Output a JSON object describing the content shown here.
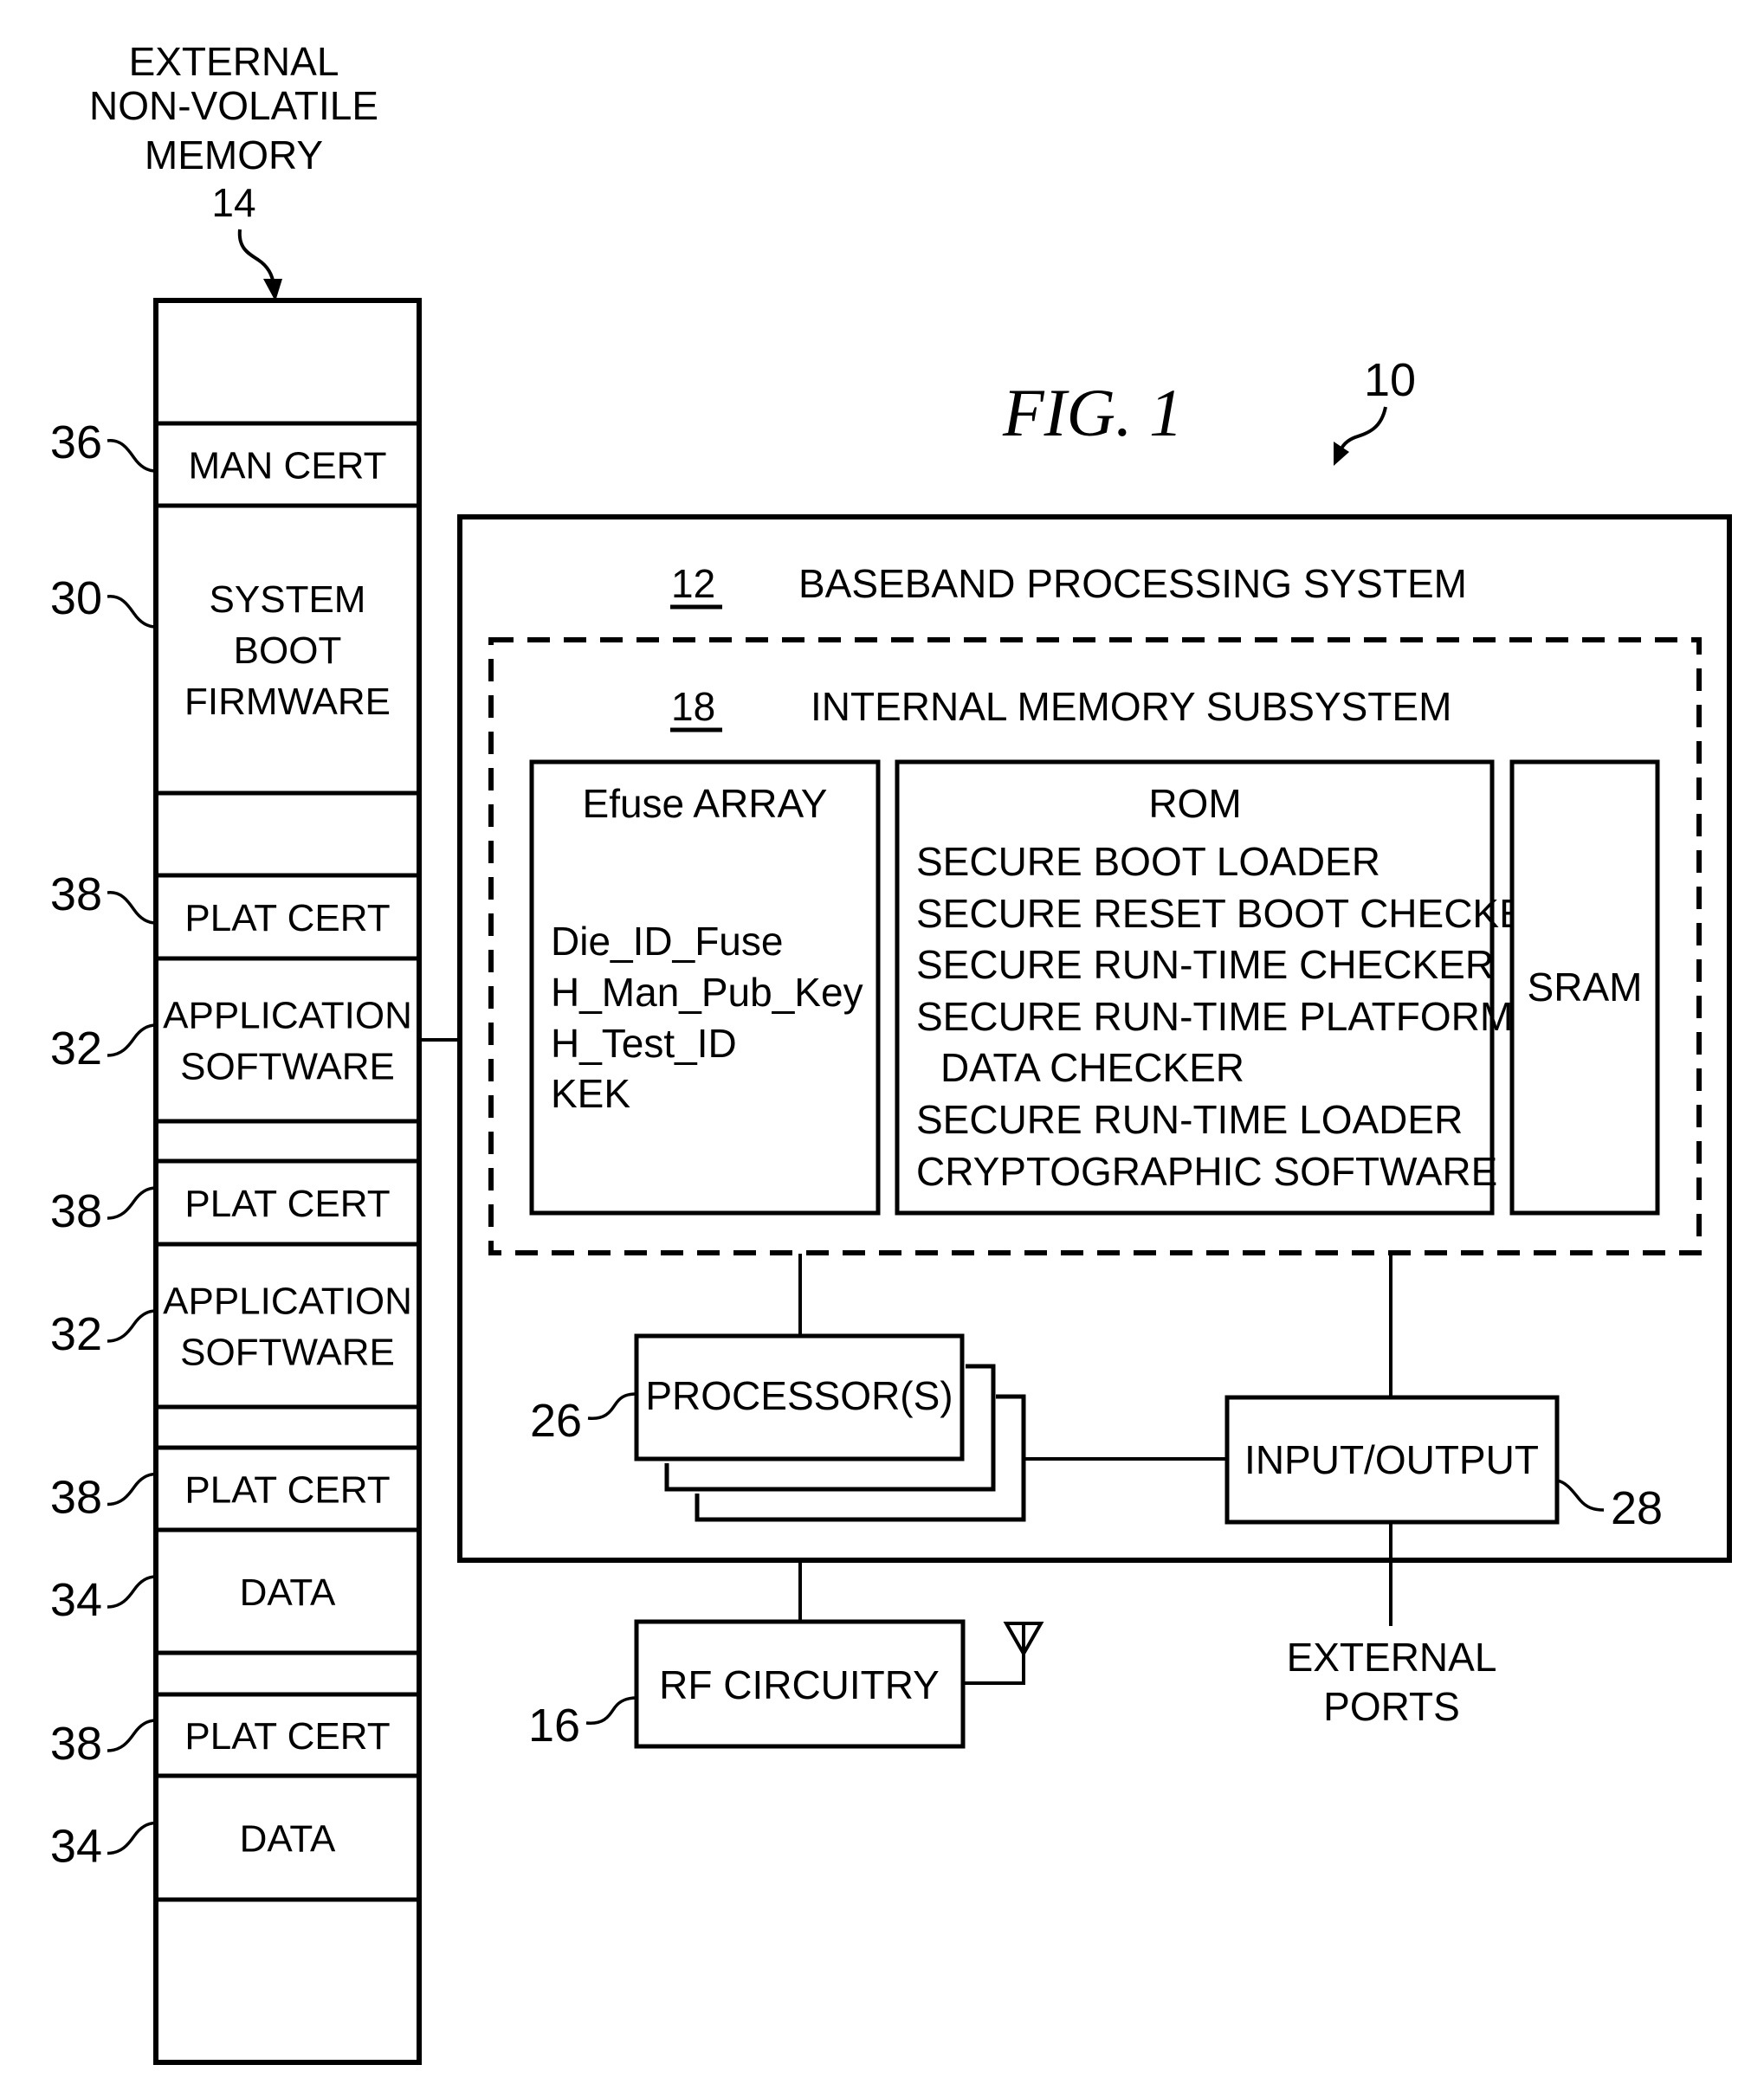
{
  "figure": {
    "title": "FIG. 1",
    "system_ref": "10"
  },
  "external_memory": {
    "title_lines": [
      "EXTERNAL",
      "NON-VOLATILE",
      "MEMORY"
    ],
    "ref": "14",
    "segments": [
      {
        "label_lines": [],
        "ref": ""
      },
      {
        "label_lines": [
          "MAN CERT"
        ],
        "ref": "36"
      },
      {
        "label_lines": [
          "SYSTEM",
          "BOOT",
          "FIRMWARE"
        ],
        "ref": "30"
      },
      {
        "label_lines": [],
        "ref": ""
      },
      {
        "label_lines": [
          "PLAT CERT"
        ],
        "ref": "38"
      },
      {
        "label_lines": [
          "APPLICATION",
          "SOFTWARE"
        ],
        "ref": "32"
      },
      {
        "label_lines": [],
        "ref": ""
      },
      {
        "label_lines": [
          "PLAT CERT"
        ],
        "ref": "38"
      },
      {
        "label_lines": [
          "APPLICATION",
          "SOFTWARE"
        ],
        "ref": "32"
      },
      {
        "label_lines": [],
        "ref": ""
      },
      {
        "label_lines": [
          "PLAT CERT"
        ],
        "ref": "38"
      },
      {
        "label_lines": [
          "DATA"
        ],
        "ref": "34"
      },
      {
        "label_lines": [],
        "ref": ""
      },
      {
        "label_lines": [
          "PLAT CERT"
        ],
        "ref": "38"
      },
      {
        "label_lines": [
          "DATA"
        ],
        "ref": "34"
      },
      {
        "label_lines": [],
        "ref": ""
      }
    ]
  },
  "baseband": {
    "ref": "12",
    "title": "BASEBAND PROCESSING SYSTEM"
  },
  "internal_memory": {
    "ref": "18",
    "title": "INTERNAL MEMORY SUBSYSTEM",
    "efuse": {
      "title": "Efuse ARRAY",
      "items": [
        "Die_ID_Fuse",
        "H_Man_Pub_Key",
        "H_Test_ID",
        "KEK"
      ]
    },
    "rom": {
      "title": "ROM",
      "items": [
        "SECURE BOOT LOADER",
        "SECURE RESET BOOT CHECKER",
        "SECURE RUN-TIME CHECKER",
        "SECURE RUN-TIME PLATFORM",
        "DATA CHECKER",
        "SECURE RUN-TIME LOADER",
        "CRYPTOGRAPHIC SOFTWARE"
      ]
    },
    "sram": {
      "title": "SRAM"
    }
  },
  "processor": {
    "label": "PROCESSOR(S)",
    "ref": "26"
  },
  "io": {
    "label": "INPUT/OUTPUT",
    "ref": "28"
  },
  "rf": {
    "label": "RF CIRCUITRY",
    "ref": "16"
  },
  "external_ports": {
    "label_lines": [
      "EXTERNAL",
      "PORTS"
    ]
  }
}
